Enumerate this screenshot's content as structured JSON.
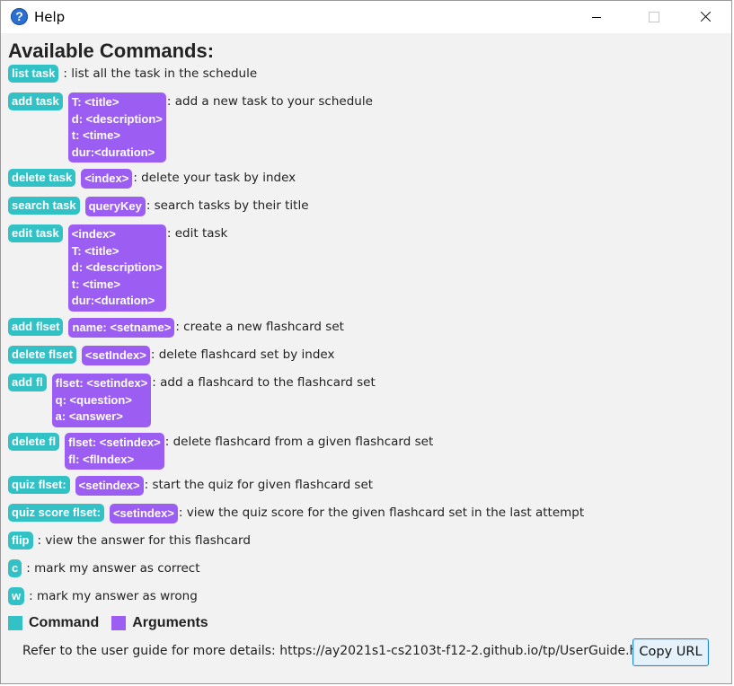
{
  "window": {
    "title": "Help",
    "app_icon_glyph": "?"
  },
  "heading": "Available Commands:",
  "commands": [
    {
      "cmd": "list task",
      "args": [],
      "desc": ": list all the task in the schedule"
    },
    {
      "cmd": "add task",
      "args": [
        "T: <title>",
        "d: <description>",
        "t: <time>",
        "dur:<duration>"
      ],
      "desc": ": add a new task to your schedule"
    },
    {
      "cmd": "delete task",
      "args": [
        "<index>"
      ],
      "desc": ": delete your task by index"
    },
    {
      "cmd": "search task",
      "args": [
        "queryKey"
      ],
      "desc": ": search tasks by their title"
    },
    {
      "cmd": "edit task",
      "args": [
        "<index>",
        "T: <title>",
        "d: <description>",
        "t: <time>",
        "dur:<duration>"
      ],
      "desc": ": edit task"
    },
    {
      "cmd": "add flset",
      "args": [
        "name: <setname>"
      ],
      "desc": ": create a new flashcard set"
    },
    {
      "cmd": "delete flset",
      "args": [
        "<setIndex>"
      ],
      "desc": ": delete flashcard set by index"
    },
    {
      "cmd": "add fl",
      "args": [
        "flset: <setindex>",
        "q: <question>",
        "a: <answer>"
      ],
      "desc": ": add a flashcard to the flashcard set"
    },
    {
      "cmd": "delete fl",
      "args": [
        "flset: <setindex>",
        "fl: <flIndex>"
      ],
      "desc": ": delete flashcard from a given flashcard set"
    },
    {
      "cmd": "quiz flset:",
      "args": [
        "<setindex>"
      ],
      "desc": ": start the quiz for given flashcard set"
    },
    {
      "cmd": "quiz score flset:",
      "args": [
        "<setindex>"
      ],
      "desc": ": view the quiz score for the given flashcard set in the last attempt"
    },
    {
      "cmd": "flip",
      "args": [],
      "desc": ": view the answer for this flashcard"
    },
    {
      "cmd": "c",
      "args": [],
      "desc": ": mark my answer as correct"
    },
    {
      "cmd": "w",
      "args": [],
      "desc": ": mark my answer as wrong"
    }
  ],
  "legend": {
    "command_label": "Command",
    "arguments_label": "Arguments",
    "command_color": "#32c2c6",
    "arguments_color": "#9b5df2"
  },
  "footer": {
    "text": "Refer to the user guide for more details: https://ay2021s1-cs2103t-f12-2.github.io/tp/UserGuide.html",
    "copy_button": "Copy URL"
  }
}
